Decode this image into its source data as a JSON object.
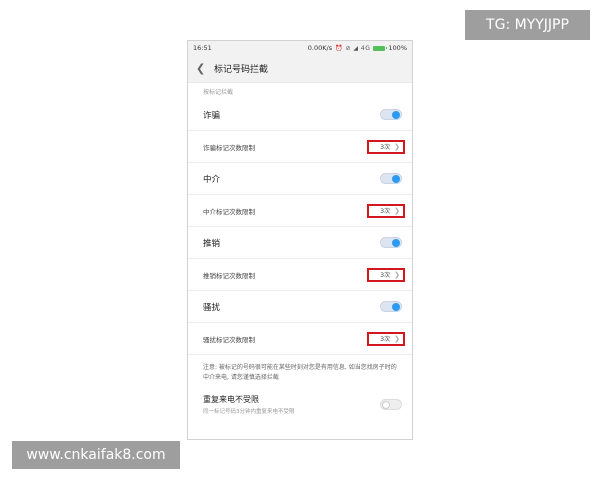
{
  "statusbar": {
    "time": "16:51",
    "speed": "0.00K/s",
    "icons": "⏰ ⊘ ◢ 4G",
    "battery": "100%"
  },
  "header": {
    "title": "标记号码拦截"
  },
  "section_label": "按标记拦截",
  "categories": [
    {
      "label": "诈骗",
      "enabled": true,
      "limit_label": "诈骗标记次数限制",
      "limit_value": "3次"
    },
    {
      "label": "中介",
      "enabled": true,
      "limit_label": "中介标记次数限制",
      "limit_value": "3次"
    },
    {
      "label": "推销",
      "enabled": true,
      "limit_label": "推销标记次数限制",
      "limit_value": "3次"
    },
    {
      "label": "骚扰",
      "enabled": true,
      "limit_label": "骚扰标记次数限制",
      "limit_value": "3次"
    }
  ],
  "note": "注意: 被标记的号码很可能在某些时刻对您是有用信息, 如当您找房子时的中介来电, 请您谨慎选择拦截",
  "repeat": {
    "title": "重复来电不受限",
    "subtitle": "同一标记号码3分钟内重复来电不受限",
    "enabled": false
  },
  "watermarks": {
    "top_right": "TG: MYYJJPP",
    "bottom_left": "www.cnkaifak8.com"
  },
  "colors": {
    "accent": "#2b9af3",
    "highlight_border": "#d2181f",
    "battery": "#53c05a"
  }
}
